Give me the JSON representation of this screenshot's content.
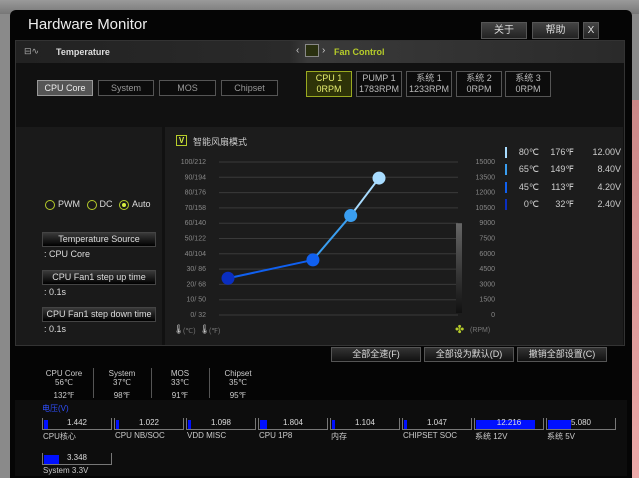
{
  "window": {
    "title": "Hardware Monitor",
    "buttons": {
      "about": "关于",
      "help": "帮助",
      "close": "X"
    }
  },
  "header": {
    "temperature": "Temperature",
    "fan_control": "Fan Control",
    "prev": "‹",
    "next": "›"
  },
  "temp_tabs": [
    {
      "label": "CPU Core",
      "selected": true
    },
    {
      "label": "System"
    },
    {
      "label": "MOS"
    },
    {
      "label": "Chipset"
    }
  ],
  "fan_tabs": [
    {
      "name": "CPU 1",
      "rpm": "0RPM",
      "selected": true
    },
    {
      "name": "PUMP 1",
      "rpm": "1783RPM"
    },
    {
      "name": "系统 1",
      "rpm": "1233RPM"
    },
    {
      "name": "系统 2",
      "rpm": "0RPM"
    },
    {
      "name": "系统 3",
      "rpm": "0RPM"
    }
  ],
  "mode": {
    "pwm": "PWM",
    "dc": "DC",
    "auto": "Auto",
    "selected": "Auto"
  },
  "settings": [
    {
      "label": "Temperature Source",
      "value": ": CPU Core"
    },
    {
      "label": "CPU Fan1 step up time",
      "value": ": 0.1s"
    },
    {
      "label": "CPU Fan1 step down time",
      "value": ": 0.1s"
    }
  ],
  "smart_fan": {
    "label": "智能风扇模式",
    "checked": true
  },
  "chart_data": {
    "type": "line",
    "left_ticks": [
      "100/212",
      "90/194",
      "80/176",
      "70/158",
      "60/140",
      "50/122",
      "40/104",
      "30/ 86",
      "20/ 68",
      "10/ 50",
      "0/ 32"
    ],
    "right_ticks": [
      "15000",
      "13500",
      "12000",
      "10500",
      "9000",
      "7500",
      "6000",
      "4500",
      "3000",
      "1500",
      "0"
    ],
    "ylim": [
      0,
      100
    ],
    "x_unit": "°C",
    "xlim": [
      0,
      80
    ],
    "points": [
      {
        "x": 0,
        "y": 24,
        "color": "#0a2ec0"
      },
      {
        "x": 45,
        "y": 36,
        "color": "#1060f0"
      },
      {
        "x": 65,
        "y": 65,
        "color": "#3a9ef0"
      },
      {
        "x": 80,
        "y": 89.5,
        "color": "#a8dcff"
      }
    ],
    "xlabel_c": "(℃)",
    "xlabel_f": "(℉)",
    "ylabel_right": "(RPM)",
    "legend": [
      {
        "c": "80℃",
        "f": "176℉",
        "v": "12.00V",
        "color": "#a8dcff"
      },
      {
        "c": "65℃",
        "f": "149℉",
        "v": "8.40V",
        "color": "#3a9ef0"
      },
      {
        "c": "45℃",
        "f": "113℉",
        "v": "4.20V",
        "color": "#1060f0"
      },
      {
        "c": "0℃",
        "f": "32℉",
        "v": "2.40V",
        "color": "#0a2ec0"
      }
    ]
  },
  "actions": {
    "full_speed": "全部全速(F)",
    "default": "全部设为默认(D)",
    "undo": "撤销全部设置(C)"
  },
  "temps": [
    {
      "name": "CPU Core",
      "c": "56℃",
      "f": "132℉"
    },
    {
      "name": "System",
      "c": "37℃",
      "f": "98℉"
    },
    {
      "name": "MOS",
      "c": "33℃",
      "f": "91℉"
    },
    {
      "name": "Chipset",
      "c": "35℃",
      "f": "95℉"
    }
  ],
  "voltage": {
    "title": "电压(V)",
    "items": [
      {
        "name": "CPU核心",
        "value": "1.442",
        "fill": 0.06
      },
      {
        "name": "CPU NB/SOC",
        "value": "1.022",
        "fill": 0.05
      },
      {
        "name": "VDD MISC",
        "value": "1.098",
        "fill": 0.05
      },
      {
        "name": "CPU 1P8",
        "value": "1.804",
        "fill": 0.1
      },
      {
        "name": "内存",
        "value": "1.104",
        "fill": 0.05
      },
      {
        "name": "CHIPSET SOC",
        "value": "1.047",
        "fill": 0.05
      },
      {
        "name": "系统 12V",
        "value": "12.216",
        "fill": 0.9
      },
      {
        "name": "系统 5V",
        "value": "5.080",
        "fill": 0.35
      },
      {
        "name": "System 3.3V",
        "value": "3.348",
        "fill": 0.23
      }
    ]
  }
}
